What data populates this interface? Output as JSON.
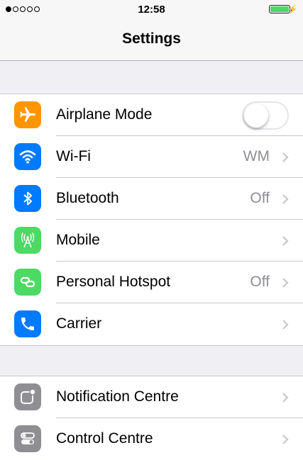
{
  "status_bar": {
    "time": "12:58",
    "signal_bars_filled": 1,
    "signal_bars_total": 5,
    "battery_color": "#4cd964",
    "battery_level": 1.0,
    "charging_icon": "bolt-icon"
  },
  "nav": {
    "title": "Settings"
  },
  "colors": {
    "orange": "#ff9500",
    "blue": "#007aff",
    "green": "#4cd964",
    "gray": "#8e8e93",
    "background": "#efeff4"
  },
  "group1": {
    "airplane": {
      "label": "Airplane Mode",
      "icon": "airplane-icon",
      "toggle_on": false
    },
    "wifi": {
      "label": "Wi-Fi",
      "value": "WM",
      "icon": "wifi-icon"
    },
    "bluetooth": {
      "label": "Bluetooth",
      "value": "Off",
      "icon": "bluetooth-icon"
    },
    "mobile": {
      "label": "Mobile",
      "icon": "antenna-icon"
    },
    "hotspot": {
      "label": "Personal Hotspot",
      "value": "Off",
      "icon": "hotspot-icon"
    },
    "carrier": {
      "label": "Carrier",
      "icon": "phone-icon"
    }
  },
  "group2": {
    "notification": {
      "label": "Notification Centre",
      "icon": "notification-centre-icon"
    },
    "control": {
      "label": "Control Centre",
      "icon": "control-centre-icon"
    }
  }
}
